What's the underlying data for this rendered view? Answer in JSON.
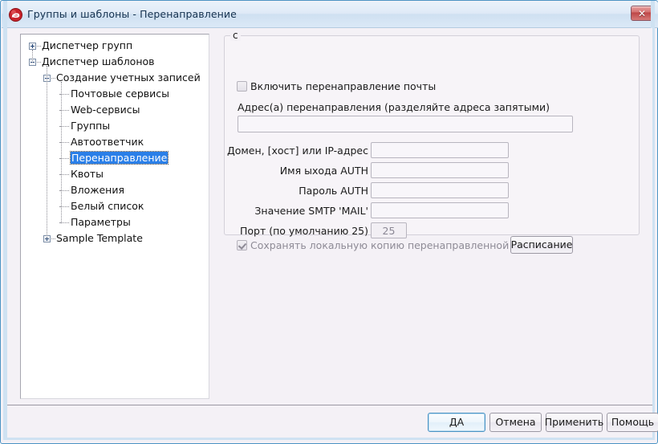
{
  "window": {
    "title": "Группы и шаблоны - Перенаправление",
    "app_icon": "red-circle-app-icon",
    "close_label": "✕",
    "accent_color": "#4a93c4",
    "titlebar_color": "#dfeaf7",
    "close_button_color": "#bd4646"
  },
  "tree": {
    "selection_color": "#2a7fe8",
    "items": [
      {
        "label": "Диспетчер групп",
        "depth": 0,
        "toggle": "plus",
        "selected": false
      },
      {
        "label": "Диспетчер шаблонов",
        "depth": 0,
        "toggle": "minus",
        "selected": false
      },
      {
        "label": "Создание учетных записей",
        "depth": 1,
        "toggle": "minus",
        "selected": false
      },
      {
        "label": "Почтовые сервисы",
        "depth": 2,
        "toggle": "none",
        "selected": false
      },
      {
        "label": "Web-сервисы",
        "depth": 2,
        "toggle": "none",
        "selected": false
      },
      {
        "label": "Группы",
        "depth": 2,
        "toggle": "none",
        "selected": false
      },
      {
        "label": "Автоответчик",
        "depth": 2,
        "toggle": "none",
        "selected": false
      },
      {
        "label": "Перенаправление",
        "depth": 2,
        "toggle": "none",
        "selected": true
      },
      {
        "label": "Квоты",
        "depth": 2,
        "toggle": "none",
        "selected": false
      },
      {
        "label": "Вложения",
        "depth": 2,
        "toggle": "none",
        "selected": false
      },
      {
        "label": "Белый список",
        "depth": 2,
        "toggle": "none",
        "selected": false
      },
      {
        "label": "Параметры",
        "depth": 2,
        "toggle": "none",
        "selected": false
      },
      {
        "label": "Sample Template",
        "depth": 1,
        "toggle": "plus",
        "selected": false
      }
    ]
  },
  "panel": {
    "legend": "с",
    "enable_forwarding": {
      "label": "Включить перенаправление почты",
      "checked": false
    },
    "address_label": "Адрес(а) перенаправления (разделяйте адреса запятыми)",
    "address_value": "",
    "fields": [
      {
        "label": "Домен, [хост] или IP-адрес",
        "value": ""
      },
      {
        "label": "Имя ыхода AUTH",
        "value": ""
      },
      {
        "label": "Пароль AUTH",
        "value": ""
      },
      {
        "label": "Значение SMTP 'MAIL'",
        "value": ""
      }
    ],
    "port": {
      "label": "Порт (по умолчанию 25)",
      "value": "25"
    },
    "keep_copy": {
      "label": "Сохранять локальную копию перенаправленной почты",
      "checked": true
    },
    "schedule_button": "Расписание"
  },
  "footer": {
    "ok": "ДА",
    "cancel": "Отмена",
    "apply": "Применить",
    "help": "Помощь"
  }
}
